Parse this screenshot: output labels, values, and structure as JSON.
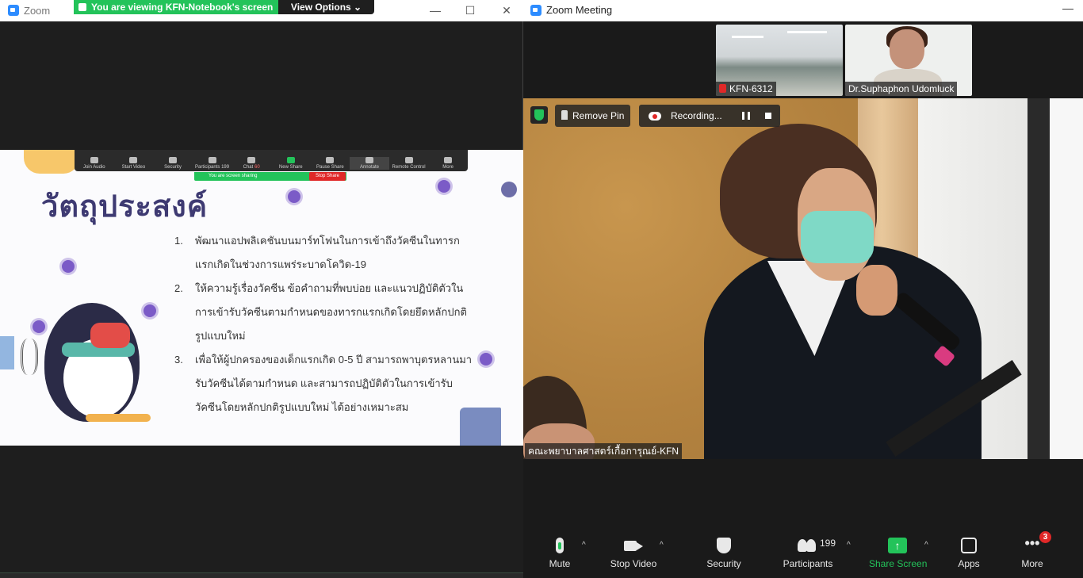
{
  "left_window": {
    "app_title": "Zoom",
    "viewing_banner": "You are viewing KFN-Notebook's screen",
    "view_options": "View Options ⌄",
    "controls": {
      "minimize": "—",
      "maximize": "☐",
      "close": "✕"
    },
    "mini_toolbar": {
      "items": [
        "Join Audio",
        "Start Video",
        "Security",
        "Participants",
        "Chat",
        "New Share",
        "Pause Share",
        "Annotate",
        "Remote Control",
        "More"
      ],
      "participants_count": "199",
      "chat_badge": "60",
      "sharing_status": "You are screen sharing",
      "stop_share": "Stop Share"
    },
    "slide": {
      "title": "วัตถุประสงค์",
      "objectives": [
        {
          "num": "1.",
          "text": "พัฒนาแอปพลิเคชันบนมาร์ทโฟนในการเข้าถึงวัคซีนในทารกแรกเกิดในช่วงการแพร่ระบาดโควิด-19"
        },
        {
          "num": "2.",
          "text": "ให้ความรู้เรื่องวัคซีน ข้อคำถามที่พบบ่อย และแนวปฏิบัติตัวในการเข้ารับวัคซีนตามกำหนดของทารกแรกเกิดโดยยึดหลักปกติรูปแบบใหม่"
        },
        {
          "num": "3.",
          "text": "เพื่อให้ผู้ปกครองของเด็กแรกเกิด 0-5 ปี สามารถพาบุตรหลานมารับวัคซีนได้ตามกำหนด และสามารถปฏิบัติตัวในการเข้ารับวัคซีนโดยหลักปกติรูปแบบใหม่ ได้อย่างเหมาะสม"
        }
      ]
    }
  },
  "right_window": {
    "app_title": "Zoom Meeting",
    "minimize": "—",
    "thumbnails": [
      {
        "name": "KFN-6312",
        "muted": true
      },
      {
        "name": "Dr.Suphaphon Udomluck",
        "muted": false
      }
    ],
    "remove_pin": "Remove Pin",
    "recording": "Recording...",
    "speaker_name": "คณะพยาบาลศาสตร์เกื้อการุณย์-KFN",
    "toolbar": {
      "mute": "Mute",
      "stop_video": "Stop Video",
      "security": "Security",
      "participants": "Participants",
      "participants_count": "199",
      "share_screen": "Share Screen",
      "apps": "Apps",
      "more": "More",
      "more_badge": "3",
      "caret": "^"
    }
  },
  "colors": {
    "zoom_blue": "#2d8cff",
    "share_green": "#23c35a",
    "alert_red": "#e02828",
    "slide_title": "#3e3a72"
  }
}
